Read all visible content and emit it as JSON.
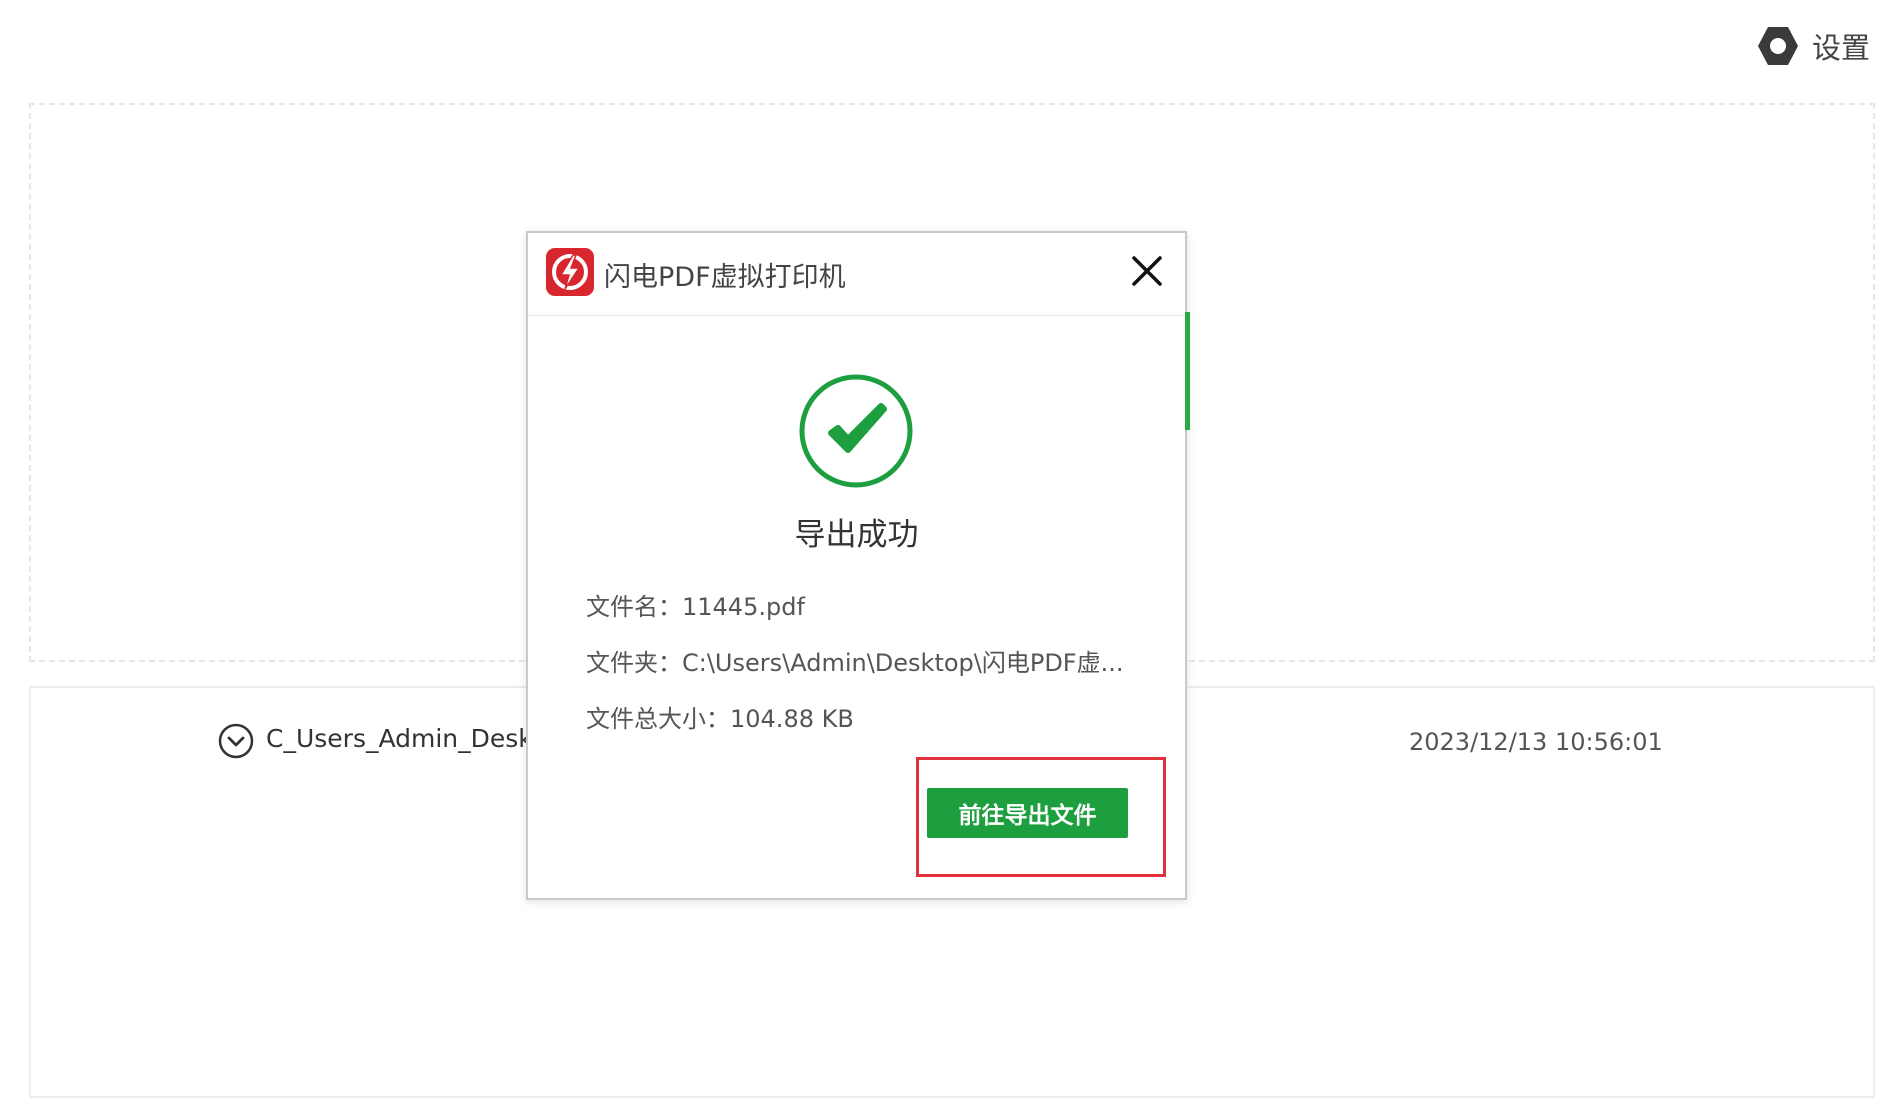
{
  "settings": {
    "label": "设置",
    "icon": "gear-icon"
  },
  "file_list": {
    "rows": [
      {
        "name": "C_Users_Admin_Deskto",
        "time": "2023/12/13 10:56:01",
        "expand_icon": "chevron-down-circle-icon"
      }
    ]
  },
  "dialog": {
    "title": "闪电PDF虚拟打印机",
    "logo_icon": "lightning-app-logo-icon",
    "close_icon": "close-icon",
    "status_icon": "check-circle-icon",
    "status_text": "导出成功",
    "file_name_label": "文件名：",
    "file_name": "11445.pdf",
    "folder_label": "文件夹：",
    "folder_path": "C:\\Users\\Admin\\Desktop\\闪电PDF虚...",
    "size_label": "文件总大小：",
    "size_value": "104.88 KB",
    "open_button_label": "前往导出文件"
  },
  "colors": {
    "accent_green": "#1e9f3f",
    "highlight_red": "#e0303a",
    "logo_red": "#d8262f"
  }
}
